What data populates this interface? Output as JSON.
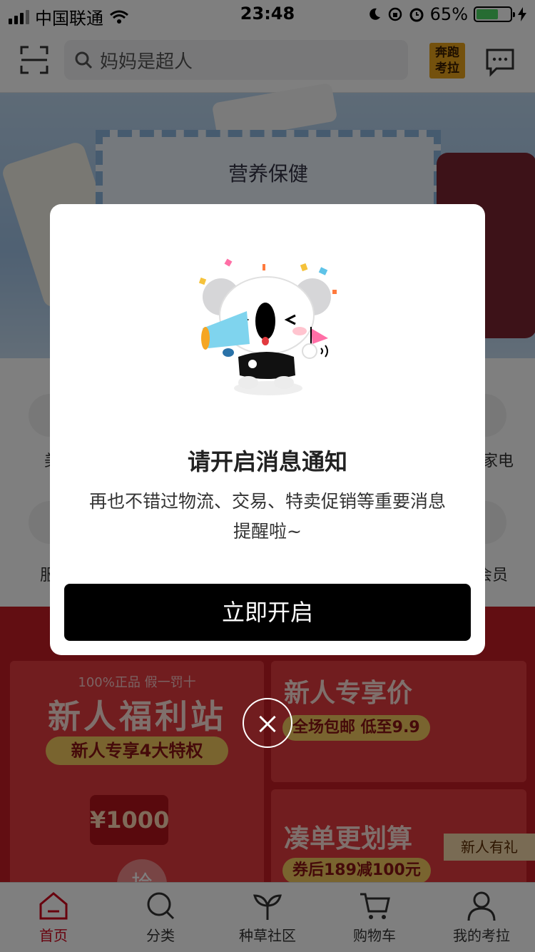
{
  "status_bar": {
    "carrier": "中国联通",
    "time": "23:48",
    "battery_percent": "65%",
    "battery_level": 0.65
  },
  "header": {
    "search_placeholder": "妈妈是超人",
    "logo_text": "奔跑考拉",
    "icons": [
      "scan-icon",
      "search-icon",
      "message-icon"
    ]
  },
  "banner": {
    "title": "营养保健"
  },
  "categories": {
    "left_visible": [
      "美",
      "服"
    ],
    "right_visible": [
      "家电",
      "会员"
    ]
  },
  "promo": {
    "left": {
      "subtitle": "100%正品 假一罚十",
      "title": "新人福利站",
      "pill": "新人专享4大特权",
      "coupon": "¥1000",
      "badge": "拾"
    },
    "right_top": {
      "title": "新人专享价",
      "pill": "全场包邮 低至9.9"
    },
    "right_bottom": {
      "title": "凑单更划算",
      "pill": "券后189减100元",
      "tag": "新人有礼"
    }
  },
  "tabbar": {
    "items": [
      {
        "label": "首页",
        "icon": "home-icon",
        "active": true
      },
      {
        "label": "分类",
        "icon": "search-icon",
        "active": false
      },
      {
        "label": "种草社区",
        "icon": "sprout-icon",
        "active": false
      },
      {
        "label": "购物车",
        "icon": "cart-icon",
        "active": false
      },
      {
        "label": "我的考拉",
        "icon": "user-icon",
        "active": false
      }
    ]
  },
  "modal": {
    "title": "请开启消息通知",
    "description": "再也不错过物流、交易、特卖促销等重要消息提醒啦~",
    "button_label": "立即开启"
  },
  "colors": {
    "accent_red": "#d0021b",
    "promo_red": "#c41d24",
    "button_black": "#000000",
    "battery_green": "#4cd964"
  }
}
